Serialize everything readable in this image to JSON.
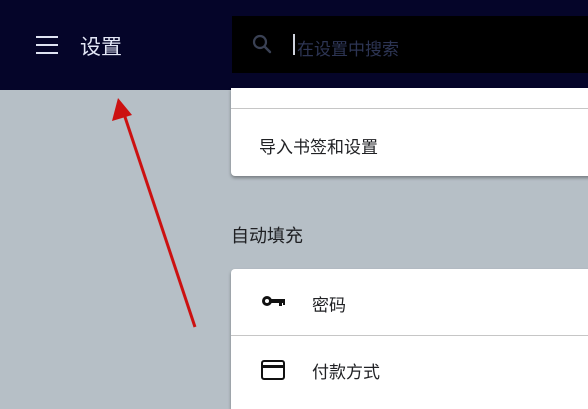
{
  "header": {
    "title": "设置",
    "search_placeholder": "在设置中搜索"
  },
  "sections": {
    "top_card": {
      "items": [
        {
          "label": "导入书签和设置"
        }
      ]
    },
    "autofill": {
      "title": "自动填充",
      "items": [
        {
          "label": "密码",
          "icon": "key-icon"
        },
        {
          "label": "付款方式",
          "icon": "credit-card-icon"
        }
      ]
    }
  },
  "colors": {
    "header_bg": "#050529",
    "search_bg": "#000000",
    "page_bg": "#b6bfc6",
    "annotation_arrow": "#cc1111"
  }
}
